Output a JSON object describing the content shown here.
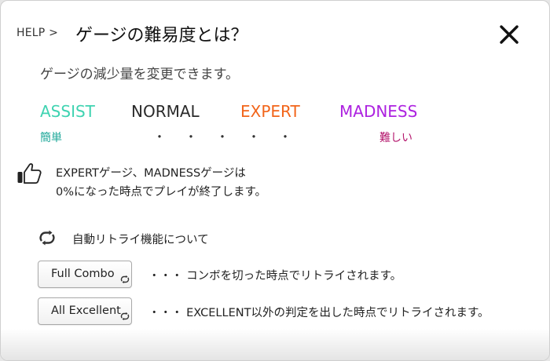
{
  "breadcrumb": "HELP >",
  "title": "ゲージの難易度とは？",
  "subtitle": "ゲージの減少量を変更できます。",
  "levels": {
    "assist": "ASSIST",
    "normal": "NORMAL",
    "expert": "EXPERT",
    "madness": "MADNESS"
  },
  "scale": {
    "easy": "簡単",
    "hard": "難しい",
    "dots": [
      "・",
      "・",
      "・",
      "・",
      "・"
    ]
  },
  "note": {
    "line1": "EXPERTゲージ、MADNESSゲージは",
    "line2": "0%になった時点でプレイが終了します。"
  },
  "retry": {
    "title": "自動リトライ機能について",
    "full_combo": {
      "label": "Full Combo",
      "desc": "・・・ コンボを切った時点でリトライされます。"
    },
    "all_excellent": {
      "label": "All Excellent",
      "desc": "・・・ EXCELLENT以外の判定を出した時点でリトライされます。"
    }
  },
  "icons": {
    "close": "close-icon",
    "thumb": "thumbs-up-icon",
    "retry": "retry-icon"
  },
  "colors": {
    "assist": "#3fd3b1",
    "normal": "#2a2a2a",
    "expert": "#f2651a",
    "madness": "#ad22e0",
    "easy": "#1fa89a",
    "hard": "#b5186e"
  }
}
